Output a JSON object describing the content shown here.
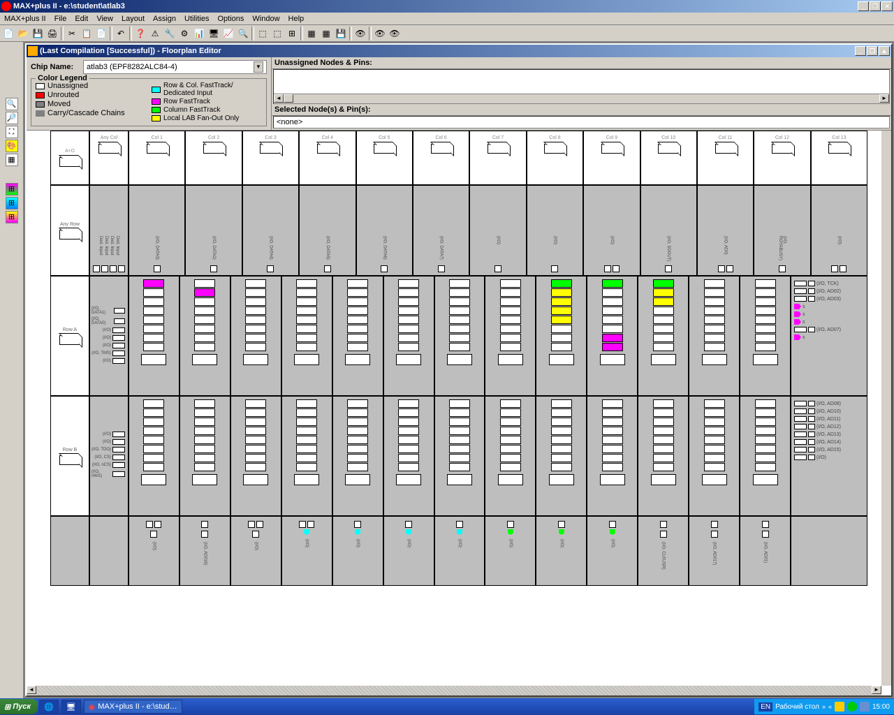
{
  "window": {
    "title": "MAX+plus II - e:\\student\\atlab3",
    "mdi_title": "(Last Compilation [Successful]) - Floorplan Editor"
  },
  "menu": [
    "MAX+plus II",
    "File",
    "Edit",
    "View",
    "Layout",
    "Assign",
    "Utilities",
    "Options",
    "Window",
    "Help"
  ],
  "chip": {
    "label": "Chip Name:",
    "value": "atlab3 (EPF8282ALC84-4)"
  },
  "legend": {
    "title": "Color Legend",
    "left": [
      {
        "color": "#ffffff",
        "label": "Unassigned"
      },
      {
        "color": "#ff0000",
        "label": "Unrouted"
      },
      {
        "color": "#808080",
        "label": "Moved"
      },
      {
        "arrow": true,
        "label": "Carry/Cascade Chains"
      }
    ],
    "right": [
      {
        "color": "#00ffff",
        "label": "Row & Col. FastTrack/ Dedicated Input"
      },
      {
        "color": "#ff00ff",
        "label": "Row FastTrack"
      },
      {
        "color": "#00ff00",
        "label": "Column FastTrack"
      },
      {
        "color": "#ffff00",
        "label": "Local LAB Fan-Out Only"
      }
    ]
  },
  "unassigned": {
    "header": "Unassigned Nodes & Pins:"
  },
  "selected": {
    "header": "Selected Node(s) & Pin(s):",
    "value": "<none>"
  },
  "floorplan": {
    "colheaders": [
      "A+D",
      "Any Col",
      "Col 1",
      "Col 2",
      "Col 3",
      "Col 4",
      "Col 5",
      "Col 6",
      "Col 7",
      "Col 8",
      "Col 9",
      "Col 10",
      "Col 11",
      "Col 12",
      "Col 13"
    ],
    "rowheaders": [
      "Any Row",
      "Row A",
      "Row B"
    ],
    "toprow_labels": {
      "anycol": [
        "Ded. Input",
        "Ded. Input",
        "Ded. Input",
        "Ded. Input"
      ],
      "cols": [
        "(I/O, DATA3)",
        "(I/O, DATA2)",
        "(I/O, DATA4)",
        "(I/O, DATA5)",
        "(I/O, DATA6)",
        "(I/O, DATA7)",
        "(I/O)",
        "(I/O)",
        "(I/O)",
        "(I/O, SDOUT)",
        "(I/O, AD0)",
        "(I/O, ROYABUSY)"
      ]
    },
    "rowA_left_labels": [
      "(I/O, DATA1)",
      "(I/O, DATA0)",
      "(I/O)",
      "(I/O)",
      "(I/O)",
      "(I/O, TMS)",
      "(I/O)"
    ],
    "rowA_right": [
      {
        "lbl": "(I/O, TCK)",
        "type": "box"
      },
      {
        "lbl": "(I/O, AD02)",
        "type": "box"
      },
      {
        "lbl": "(I/O, AD03)",
        "type": "box"
      },
      {
        "lbl": "s",
        "type": "arrow"
      },
      {
        "lbl": "s",
        "type": "arrow"
      },
      {
        "lbl": "s",
        "type": "arrow"
      },
      {
        "lbl": "(I/O, AD07)",
        "type": "box"
      },
      {
        "lbl": "s",
        "type": "arrow"
      }
    ],
    "rowB_left_labels": [
      "(I/O)",
      "(I/O)",
      "(I/O, TDO)",
      "(I/O, CS)",
      "(I/O, nCS)",
      "(I/O, nWS)"
    ],
    "rowB_right": [
      {
        "lbl": "(I/O, AD08)"
      },
      {
        "lbl": "(I/O, AD10)"
      },
      {
        "lbl": "(I/O, AD11)"
      },
      {
        "lbl": "(I/O, AD12)"
      },
      {
        "lbl": "(I/O, AD13)"
      },
      {
        "lbl": "(I/O, AD14)"
      },
      {
        "lbl": "(I/O, AD15)"
      },
      {
        "lbl": "(I/O)"
      }
    ],
    "bottom_labels": [
      "(I/O)",
      "(I/O, AD016)",
      "(I/O)",
      "(I/O)",
      "(I/O)",
      "(I/O)",
      "(I/O)",
      "(I/O)",
      "(I/O)",
      "(I/O)",
      "(I/O, CLKUSR)",
      "(I/O, AD017)",
      "(I/O, AD01)"
    ],
    "rowA_cells": {
      "1": [
        "magenta",
        "",
        "",
        "",
        "",
        "",
        "",
        ""
      ],
      "2": [
        "",
        "magenta",
        "",
        "",
        "",
        "",
        "",
        ""
      ],
      "9": [
        "green",
        "yellow",
        "yellow",
        "yellow",
        "yellow",
        "",
        "",
        ""
      ],
      "10": [
        "green",
        "",
        "",
        "",
        "",
        "",
        "magenta",
        "magenta"
      ],
      "11": [
        "green",
        "yellow",
        "yellow",
        "",
        "",
        "",
        "",
        ""
      ]
    }
  },
  "taskbar": {
    "start": "Пуск",
    "task": "MAX+plus II - e:\\stud…",
    "desktop_label": "Рабочий стол",
    "lang": "EN",
    "time": "15:00"
  }
}
